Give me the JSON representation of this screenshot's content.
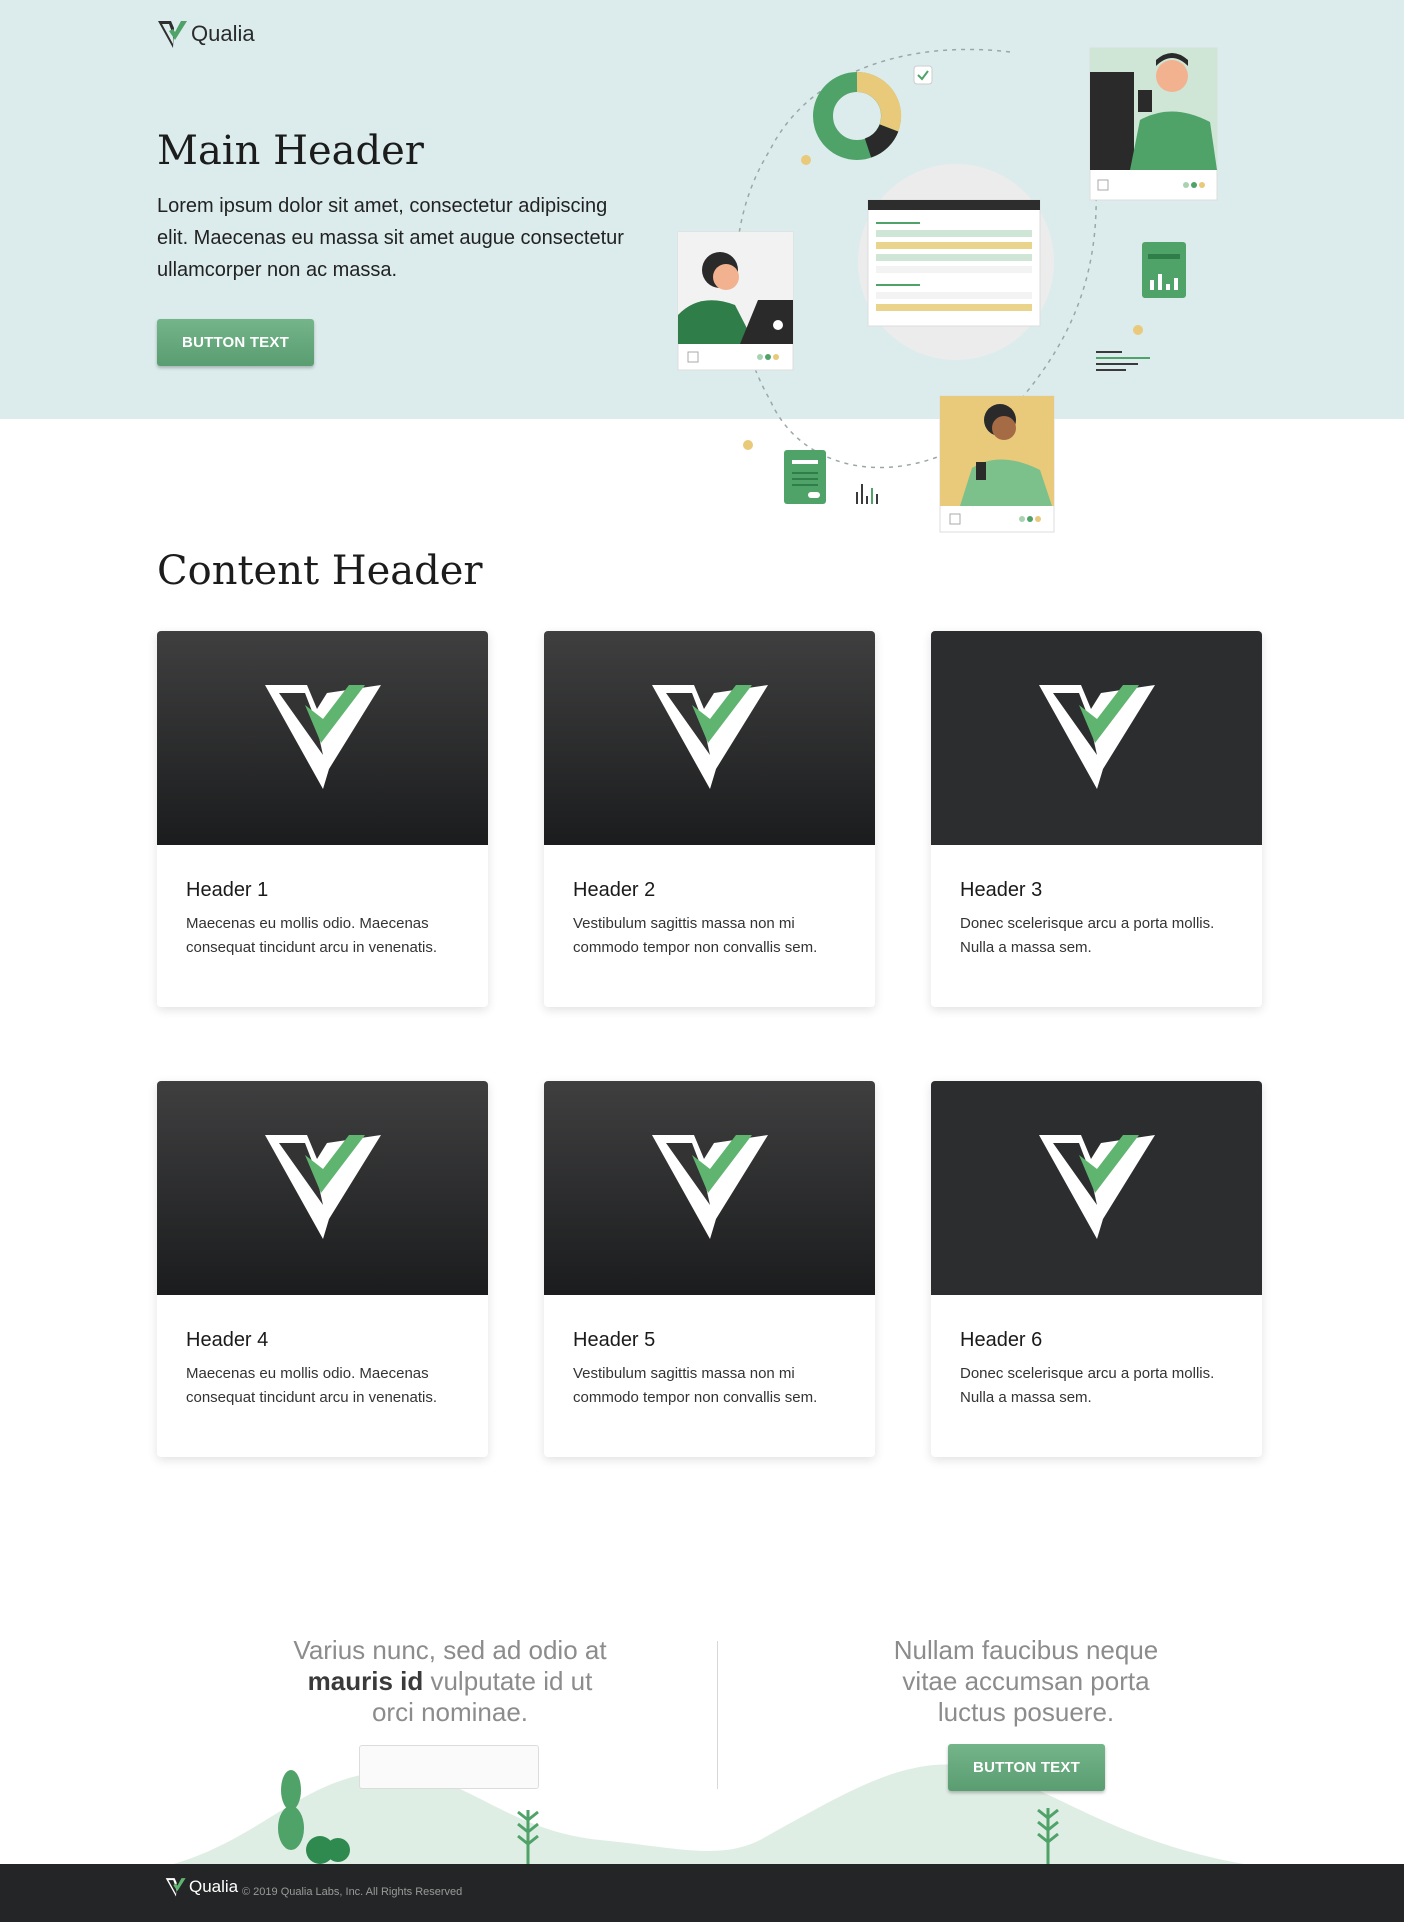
{
  "brand": {
    "name": "Qualia",
    "accent": "#5fb46f",
    "dark": "#232526"
  },
  "hero": {
    "title": "Main Header",
    "text": "Lorem ipsum dolor sit amet, consectetur adipiscing elit. Maecenas eu massa sit amet augue consectetur ullamcorper non ac massa.",
    "button_label": "BUTTON TEXT"
  },
  "content": {
    "title": "Content Header",
    "cards": [
      {
        "title": "Header 1",
        "text": "Maecenas eu mollis odio. Maecenas consequat tincidunt arcu in venenatis.",
        "image": "qualia-logo-mark"
      },
      {
        "title": "Header 2",
        "text": "Vestibulum sagittis massa non mi commodo tempor non convallis sem.",
        "image": "qualia-logo-mark"
      },
      {
        "title": "Header 3",
        "text": "Donec scelerisque arcu a porta mollis. Nulla a massa sem.",
        "image": "qualia-logo-mark"
      },
      {
        "title": "Header 4",
        "text": "Maecenas eu mollis odio. Maecenas consequat tincidunt arcu in venenatis.",
        "image": "qualia-logo-mark"
      },
      {
        "title": "Header 5",
        "text": "Vestibulum sagittis massa non mi commodo tempor non convallis sem.",
        "image": "qualia-logo-mark"
      },
      {
        "title": "Header 6",
        "text": "Donec scelerisque arcu a porta mollis. Nulla a massa sem.",
        "image": "qualia-logo-mark"
      }
    ]
  },
  "cta": {
    "left_pre": "Varius nunc, sed ad odio at ",
    "left_bold": "mauris id",
    "left_post": " vulputate id ut orci nominae.",
    "input_placeholder": "",
    "right_text": "Nullam faucibus neque vitae accumsan porta luctus posuere.",
    "button_label": "BUTTON TEXT"
  },
  "footer": {
    "brand": "Qualia",
    "copyright": "© 2019 Qualia Labs, Inc. All Rights Reserved"
  }
}
